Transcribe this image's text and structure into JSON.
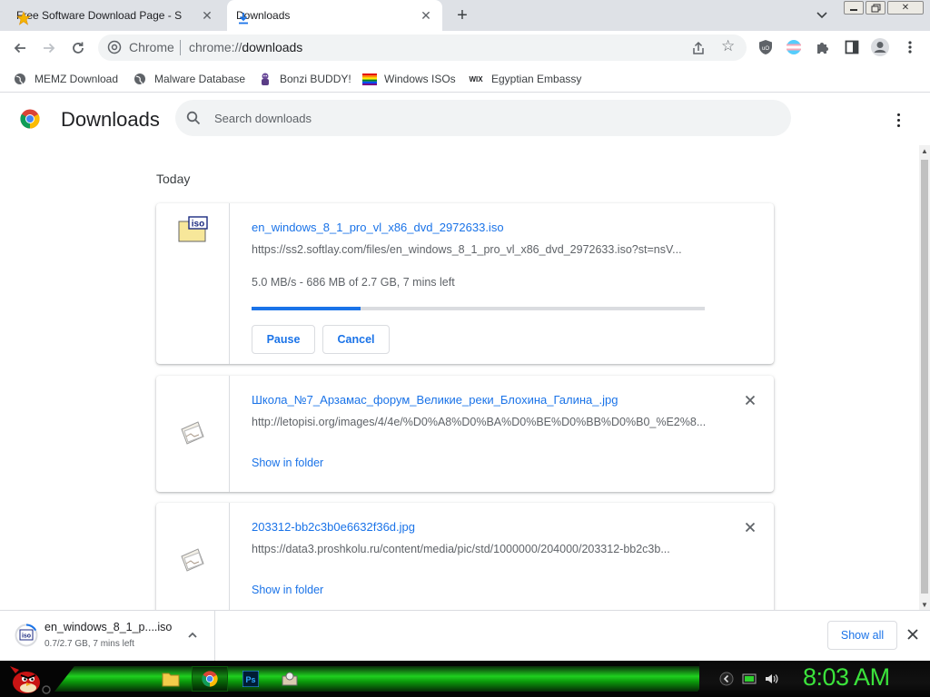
{
  "tabs": [
    {
      "title": "Free Software Download Page - S"
    },
    {
      "title": "Downloads"
    }
  ],
  "omnibox": {
    "chip": "Chrome",
    "url_scheme": "chrome://",
    "url_path": "downloads"
  },
  "bookmarks": [
    {
      "label": "MEMZ Download",
      "icon": "globe-icon"
    },
    {
      "label": "Malware Database",
      "icon": "globe-icon"
    },
    {
      "label": "Bonzi BUDDY!",
      "icon": "bonzi-icon"
    },
    {
      "label": "Windows ISOs",
      "icon": "rainbow-flag-icon"
    },
    {
      "label": "Egyptian Embassy",
      "icon": "wix-icon"
    }
  ],
  "page": {
    "title": "Downloads",
    "search_placeholder": "Search downloads",
    "section": "Today"
  },
  "downloads": [
    {
      "name": "en_windows_8_1_pro_vl_x86_dvd_2972633.iso",
      "url": "https://ss2.softlay.com/files/en_windows_8_1_pro_vl_x86_dvd_2972633.iso?st=nsV...",
      "status": "5.0 MB/s - 686 MB of 2.7 GB, 7 mins left",
      "progress": 0.24,
      "pause_label": "Pause",
      "cancel_label": "Cancel"
    },
    {
      "name": "Школа_№7_Арзамас_форум_Великие_реки_Блохина_Галина_.jpg",
      "url": "http://letopisi.org/images/4/4e/%D0%A8%D0%BA%D0%BE%D0%BB%D0%B0_%E2%8...",
      "link": "Show in folder"
    },
    {
      "name": "203312-bb2c3b0e6632f36d.jpg",
      "url": "https://data3.proshkolu.ru/content/media/pic/std/1000000/204000/203312-bb2c3b...",
      "link": "Show in folder"
    }
  ],
  "shelf": {
    "name": "en_windows_8_1_p....iso",
    "status": "0.7/2.7 GB, 7 mins left",
    "show_all": "Show all"
  },
  "taskbar": {
    "clock": "8:03 AM"
  },
  "colors": {
    "accent": "#1a73e8",
    "clock": "#3be23b"
  }
}
